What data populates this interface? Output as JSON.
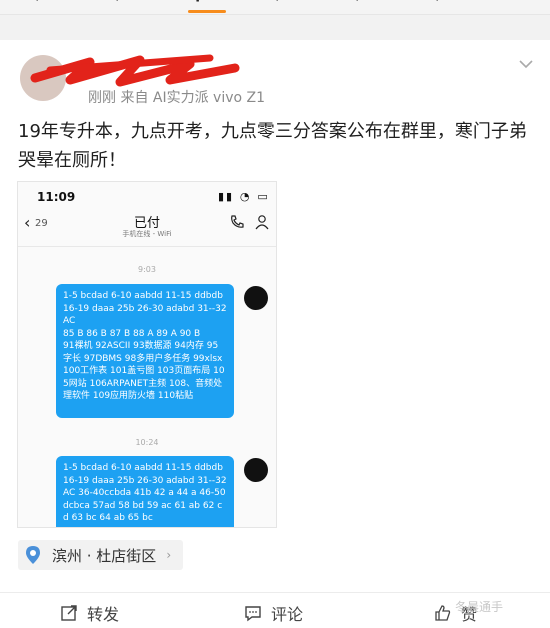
{
  "nav": {
    "tabs": [
      "·",
      "·",
      "·",
      "·",
      "·",
      "·"
    ],
    "active_index": 2
  },
  "post": {
    "meta": "刚刚  来自 AI实力派 vivo Z1",
    "text": "19年专升本，九点开考，九点零三分答案公布在群里，寒门子弟哭晕在厕所！"
  },
  "phone": {
    "status_time": "11:09",
    "back_count": "29",
    "chat_title": "已付",
    "chat_subtitle": "手机在线 - WiFi",
    "timestamp1": "9:03",
    "message1": "1-5  bcdad  6-10  aabdd  11-15 ddbdb 16-19 daaa 25b 26-30 adabd 31--32AC\n85 B  86 B  87 B  88 A  89 A  90 B\n91裸机  92ASCII  93数据源  94内存 95字长  97DBMS  98多用户多任务 99xlsx  100工作表  101盖亏图  103页面布局  105网站  106ARPANET主频 108、音频处理软件    109应用防火墙  110粘贴",
    "timestamp2": "10:24",
    "message2": "1-5  bcdad  6-10  aabdd  11-15 ddbdb 16-19 daaa 25b 26-30 adabd 31--32AC  36-40ccbda 41b 42 a 44 a  46-50 dcbca  57ad 58 bd 59 ac 61 ab 62 cd 63 bc 64 ab 65 bc"
  },
  "location": {
    "label": "滨州 · 杜店街区",
    "icon": "location-pin-icon"
  },
  "actions": {
    "repost": "转发",
    "comment": "评论",
    "like": "赞"
  },
  "watermark": "冬晨通手",
  "colors": {
    "bubble": "#1da1f2",
    "accent": "#f78c1c"
  }
}
